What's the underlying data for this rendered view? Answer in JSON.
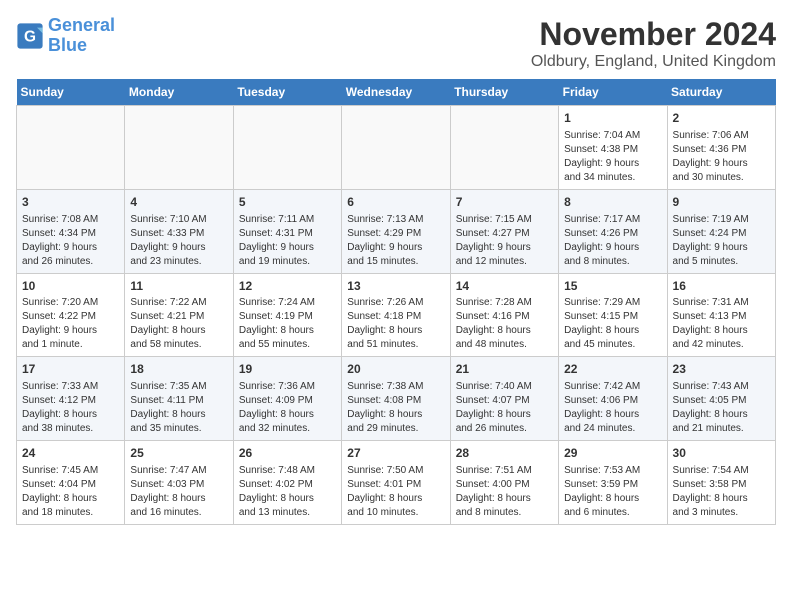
{
  "header": {
    "logo_line1": "General",
    "logo_line2": "Blue",
    "month": "November 2024",
    "location": "Oldbury, England, United Kingdom"
  },
  "weekdays": [
    "Sunday",
    "Monday",
    "Tuesday",
    "Wednesday",
    "Thursday",
    "Friday",
    "Saturday"
  ],
  "weeks": [
    [
      {
        "day": "",
        "content": ""
      },
      {
        "day": "",
        "content": ""
      },
      {
        "day": "",
        "content": ""
      },
      {
        "day": "",
        "content": ""
      },
      {
        "day": "",
        "content": ""
      },
      {
        "day": "1",
        "content": "Sunrise: 7:04 AM\nSunset: 4:38 PM\nDaylight: 9 hours\nand 34 minutes."
      },
      {
        "day": "2",
        "content": "Sunrise: 7:06 AM\nSunset: 4:36 PM\nDaylight: 9 hours\nand 30 minutes."
      }
    ],
    [
      {
        "day": "3",
        "content": "Sunrise: 7:08 AM\nSunset: 4:34 PM\nDaylight: 9 hours\nand 26 minutes."
      },
      {
        "day": "4",
        "content": "Sunrise: 7:10 AM\nSunset: 4:33 PM\nDaylight: 9 hours\nand 23 minutes."
      },
      {
        "day": "5",
        "content": "Sunrise: 7:11 AM\nSunset: 4:31 PM\nDaylight: 9 hours\nand 19 minutes."
      },
      {
        "day": "6",
        "content": "Sunrise: 7:13 AM\nSunset: 4:29 PM\nDaylight: 9 hours\nand 15 minutes."
      },
      {
        "day": "7",
        "content": "Sunrise: 7:15 AM\nSunset: 4:27 PM\nDaylight: 9 hours\nand 12 minutes."
      },
      {
        "day": "8",
        "content": "Sunrise: 7:17 AM\nSunset: 4:26 PM\nDaylight: 9 hours\nand 8 minutes."
      },
      {
        "day": "9",
        "content": "Sunrise: 7:19 AM\nSunset: 4:24 PM\nDaylight: 9 hours\nand 5 minutes."
      }
    ],
    [
      {
        "day": "10",
        "content": "Sunrise: 7:20 AM\nSunset: 4:22 PM\nDaylight: 9 hours\nand 1 minute."
      },
      {
        "day": "11",
        "content": "Sunrise: 7:22 AM\nSunset: 4:21 PM\nDaylight: 8 hours\nand 58 minutes."
      },
      {
        "day": "12",
        "content": "Sunrise: 7:24 AM\nSunset: 4:19 PM\nDaylight: 8 hours\nand 55 minutes."
      },
      {
        "day": "13",
        "content": "Sunrise: 7:26 AM\nSunset: 4:18 PM\nDaylight: 8 hours\nand 51 minutes."
      },
      {
        "day": "14",
        "content": "Sunrise: 7:28 AM\nSunset: 4:16 PM\nDaylight: 8 hours\nand 48 minutes."
      },
      {
        "day": "15",
        "content": "Sunrise: 7:29 AM\nSunset: 4:15 PM\nDaylight: 8 hours\nand 45 minutes."
      },
      {
        "day": "16",
        "content": "Sunrise: 7:31 AM\nSunset: 4:13 PM\nDaylight: 8 hours\nand 42 minutes."
      }
    ],
    [
      {
        "day": "17",
        "content": "Sunrise: 7:33 AM\nSunset: 4:12 PM\nDaylight: 8 hours\nand 38 minutes."
      },
      {
        "day": "18",
        "content": "Sunrise: 7:35 AM\nSunset: 4:11 PM\nDaylight: 8 hours\nand 35 minutes."
      },
      {
        "day": "19",
        "content": "Sunrise: 7:36 AM\nSunset: 4:09 PM\nDaylight: 8 hours\nand 32 minutes."
      },
      {
        "day": "20",
        "content": "Sunrise: 7:38 AM\nSunset: 4:08 PM\nDaylight: 8 hours\nand 29 minutes."
      },
      {
        "day": "21",
        "content": "Sunrise: 7:40 AM\nSunset: 4:07 PM\nDaylight: 8 hours\nand 26 minutes."
      },
      {
        "day": "22",
        "content": "Sunrise: 7:42 AM\nSunset: 4:06 PM\nDaylight: 8 hours\nand 24 minutes."
      },
      {
        "day": "23",
        "content": "Sunrise: 7:43 AM\nSunset: 4:05 PM\nDaylight: 8 hours\nand 21 minutes."
      }
    ],
    [
      {
        "day": "24",
        "content": "Sunrise: 7:45 AM\nSunset: 4:04 PM\nDaylight: 8 hours\nand 18 minutes."
      },
      {
        "day": "25",
        "content": "Sunrise: 7:47 AM\nSunset: 4:03 PM\nDaylight: 8 hours\nand 16 minutes."
      },
      {
        "day": "26",
        "content": "Sunrise: 7:48 AM\nSunset: 4:02 PM\nDaylight: 8 hours\nand 13 minutes."
      },
      {
        "day": "27",
        "content": "Sunrise: 7:50 AM\nSunset: 4:01 PM\nDaylight: 8 hours\nand 10 minutes."
      },
      {
        "day": "28",
        "content": "Sunrise: 7:51 AM\nSunset: 4:00 PM\nDaylight: 8 hours\nand 8 minutes."
      },
      {
        "day": "29",
        "content": "Sunrise: 7:53 AM\nSunset: 3:59 PM\nDaylight: 8 hours\nand 6 minutes."
      },
      {
        "day": "30",
        "content": "Sunrise: 7:54 AM\nSunset: 3:58 PM\nDaylight: 8 hours\nand 3 minutes."
      }
    ]
  ]
}
